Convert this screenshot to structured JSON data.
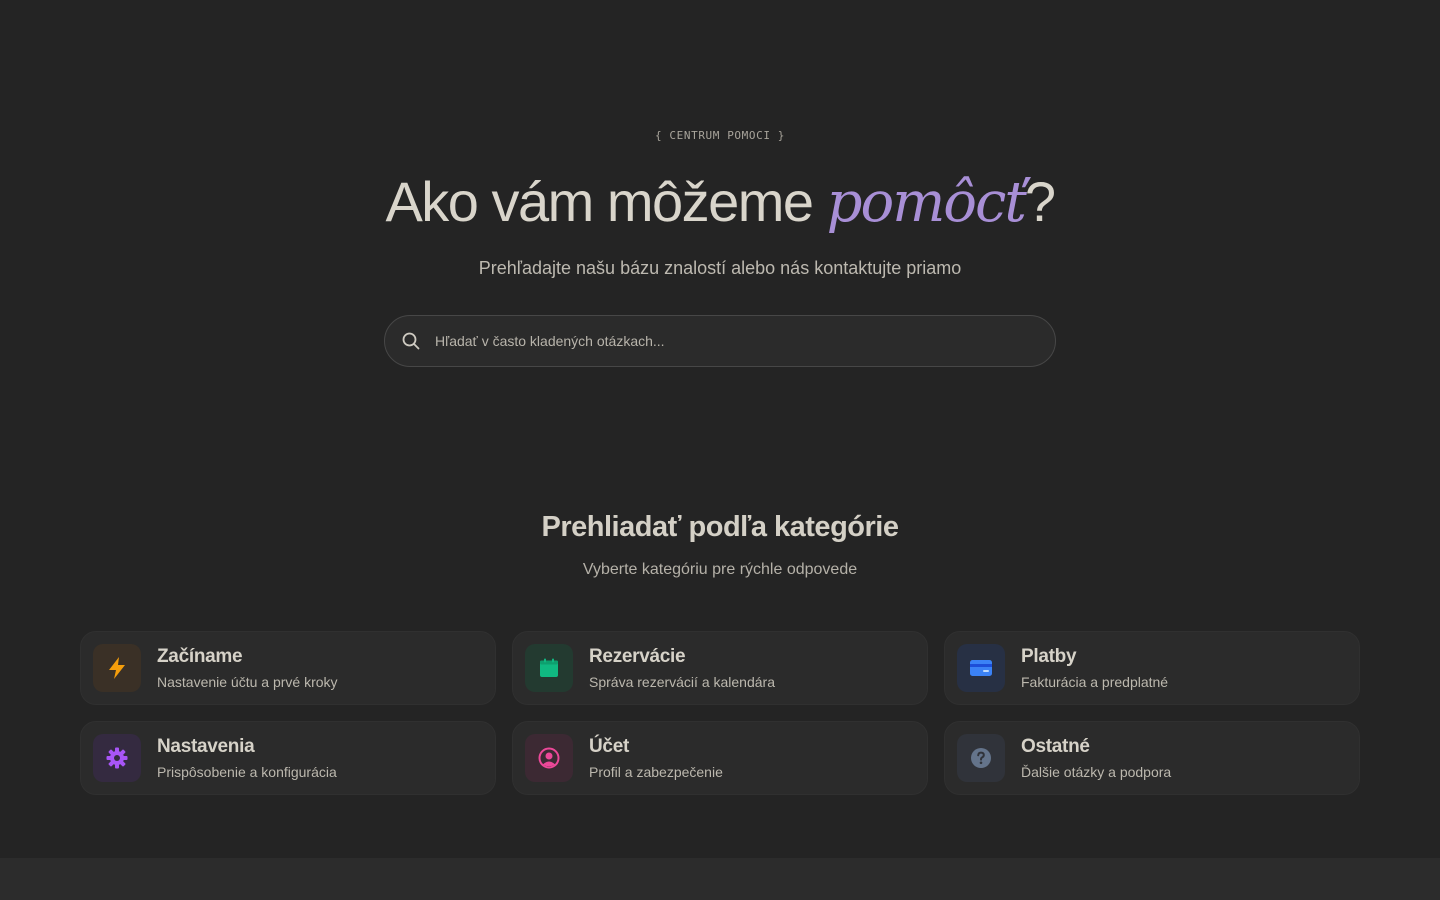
{
  "hero": {
    "eyebrow": "{ CENTRUM POMOCI }",
    "headline_main": "Ako vám môžeme ",
    "headline_accent": "pomôcť",
    "headline_end": "?",
    "subtitle": "Prehľadajte našu bázu znalostí alebo nás kontaktujte priamo"
  },
  "search": {
    "placeholder": "Hľadať v často kladených otázkach..."
  },
  "categories_section": {
    "title": "Prehliadať podľa kategórie",
    "subtitle": "Vyberte kategóriu pre rýchle odpovede"
  },
  "categories": [
    {
      "title": "Začíname",
      "desc": "Nastavenie účtu a prvé kroky",
      "icon": "lightning-icon",
      "color": "#f59e0b",
      "bg": "#3a3026"
    },
    {
      "title": "Rezervácie",
      "desc": "Správa rezervácií a kalendára",
      "icon": "calendar-icon",
      "color": "#10b981",
      "bg": "#233a30"
    },
    {
      "title": "Platby",
      "desc": "Fakturácia a predplatné",
      "icon": "credit-card-icon",
      "color": "#3b82f6",
      "bg": "#273044"
    },
    {
      "title": "Nastavenia",
      "desc": "Prispôsobenie a konfigurácia",
      "icon": "gear-icon",
      "color": "#a855f7",
      "bg": "#342a40"
    },
    {
      "title": "Účet",
      "desc": "Profil a zabezpečenie",
      "icon": "user-circle-icon",
      "color": "#ec4899",
      "bg": "#3c2933"
    },
    {
      "title": "Ostatné",
      "desc": "Ďalšie otázky a podpora",
      "icon": "question-icon",
      "color": "#64748b",
      "bg": "#30333a"
    }
  ]
}
